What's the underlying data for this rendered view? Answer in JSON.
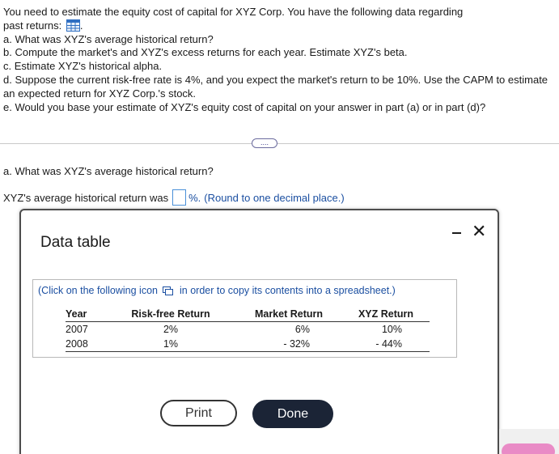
{
  "question": {
    "line1": "You need to estimate the equity cost of capital for XYZ Corp. You have the following data regarding",
    "line2": "past returns:",
    "line2_suffix": ".",
    "parts": [
      "a. What was XYZ's average historical return?",
      "b. Compute the market's and XYZ's excess returns for each year. Estimate XYZ's beta.",
      "c. Estimate XYZ's historical alpha.",
      "d. Suppose the current risk-free rate is 4%, and you expect the market's return to be 10%. Use the CAPM to estimate",
      "an expected return for XYZ Corp.'s stock.",
      "e. Would you base your estimate of XYZ's equity cost of capital on your answer in part (a) or in part (d)?"
    ]
  },
  "more_button_label": "....",
  "part_a": {
    "prompt": "a. What was XYZ's average historical return?",
    "answer_prefix": "XYZ's average historical return was",
    "answer_value": "",
    "answer_suffix": "%.",
    "hint": "(Round to one decimal place.)"
  },
  "dialog": {
    "title": "Data table",
    "minimize_icon": "minimize-icon",
    "close_icon": "close-icon",
    "close_glyph": "✕",
    "click_note_prefix": "(Click on the following icon",
    "click_note_suffix": "in order to copy its contents into a spreadsheet.)",
    "table": {
      "headers": [
        "Year",
        "Risk-free Return",
        "Market Return",
        "XYZ Return"
      ],
      "rows": [
        [
          "2007",
          "2%",
          "6%",
          "10%"
        ],
        [
          "2008",
          "1%",
          "- 32%",
          "- 44%"
        ]
      ]
    },
    "print_label": "Print",
    "done_label": "Done"
  },
  "colors": {
    "link_blue": "#1b4fa1",
    "done_bg": "#1b2436",
    "input_border": "#4a90d9",
    "accent_pink": "#e98bc6"
  }
}
